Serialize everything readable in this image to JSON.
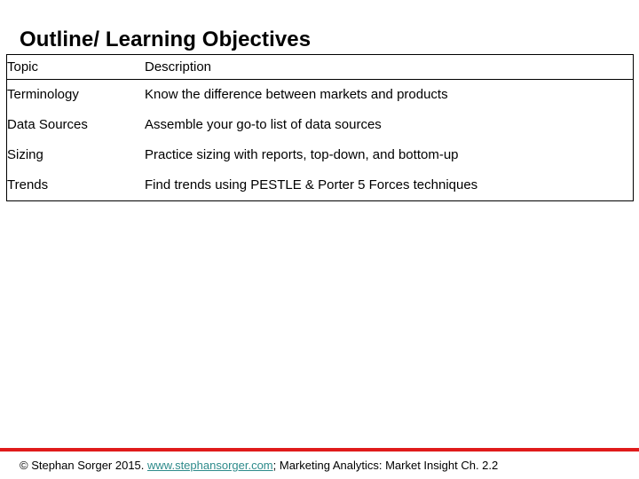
{
  "slide": {
    "title": "Outline/ Learning Objectives"
  },
  "table": {
    "headers": {
      "topic": "Topic",
      "description": "Description"
    },
    "rows": [
      {
        "topic": "Terminology",
        "description": "Know the difference between markets and products"
      },
      {
        "topic": "Data Sources",
        "description": "Assemble your go-to list of data sources"
      },
      {
        "topic": "Sizing",
        "description": "Practice sizing with reports, top-down, and bottom-up"
      },
      {
        "topic": "Trends",
        "description": "Find trends using PESTLE & Porter 5 Forces techniques"
      }
    ]
  },
  "footer": {
    "prefix": "© Stephan Sorger 2015. ",
    "link": "www.stephansorger.com",
    "suffix": "; Marketing Analytics: Market Insight Ch. 2.2",
    "rule_color": "#E01B1B",
    "link_color": "#2E8B8B"
  }
}
